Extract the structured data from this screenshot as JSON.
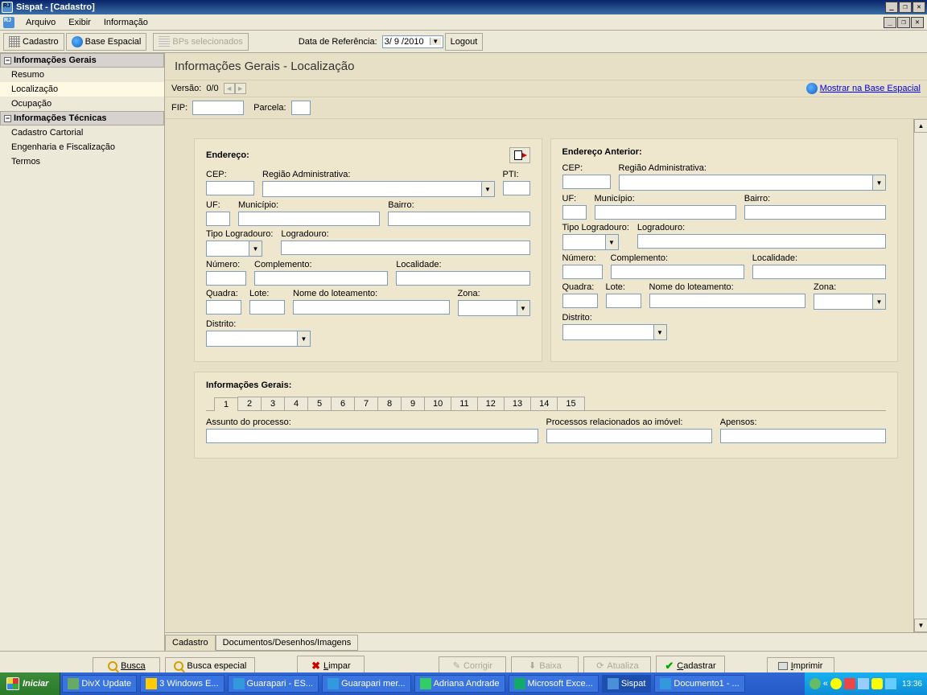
{
  "window": {
    "title": "Sispat - [Cadastro]"
  },
  "menu": {
    "arquivo": "Arquivo",
    "exibir": "Exibir",
    "informacao": "Informação"
  },
  "toolbar": {
    "cadastro": "Cadastro",
    "base_espacial": "Base Espacial",
    "bps": "BPs selecionados",
    "data_ref_label": "Data de Referência:",
    "data_ref_value": "3/ 9 /2010",
    "logout": "Logout"
  },
  "sidebar": {
    "group1": "Informações Gerais",
    "items1": {
      "resumo": "Resumo",
      "localizacao": "Localização",
      "ocupacao": "Ocupação"
    },
    "group2": "Informações Técnicas",
    "items2": {
      "cartorial": "Cadastro Cartorial",
      "engenharia": "Engenharia e Fiscalização",
      "termos": "Termos"
    }
  },
  "page": {
    "title": "Informações Gerais - Localização",
    "versao_label": "Versão:",
    "versao_value": "0/0",
    "base_link": "Mostrar na Base Espacial",
    "fip_label": "FIP:",
    "parcela_label": "Parcela:"
  },
  "endereco": {
    "title": "Endereço:",
    "title_ant": "Endereço Anterior:",
    "cep": "CEP:",
    "regiao": "Região Administrativa:",
    "pti": "PTI:",
    "uf": "UF:",
    "municipio": "Município:",
    "bairro": "Bairro:",
    "tipo_log": "Tipo Logradouro:",
    "logradouro": "Logradouro:",
    "numero": "Número:",
    "complemento": "Complemento:",
    "localidade": "Localidade:",
    "quadra": "Quadra:",
    "lote": "Lote:",
    "nome_lot": "Nome do loteamento:",
    "zona": "Zona:",
    "distrito": "Distrito:"
  },
  "info_gerais": {
    "title": "Informações Gerais:",
    "tabs": [
      "1",
      "2",
      "3",
      "4",
      "5",
      "6",
      "7",
      "8",
      "9",
      "10",
      "11",
      "12",
      "13",
      "14",
      "15"
    ],
    "assunto": "Assunto do processo:",
    "processos_rel": "Processos relacionados ao imóvel:",
    "apensos": "Apensos:"
  },
  "bottom_tabs": {
    "cadastro": "Cadastro",
    "docs": "Documentos/Desenhos/Imagens"
  },
  "buttons": {
    "busca": "Busca",
    "busca_esp": "Busca especial",
    "limpar": "Limpar",
    "corrigir": "Corrigir",
    "baixa": "Baixa",
    "atualiza": "Atualiza",
    "cadastrar": "Cadastrar",
    "imprimir": "Imprimir"
  },
  "taskbar": {
    "start": "Iniciar",
    "items": [
      "DivX Update",
      "3 Windows E...",
      "Guarapari - ES...",
      "Guarapari mer...",
      "Adriana Andrade",
      "Microsoft Exce...",
      "Sispat",
      "Documento1 - ..."
    ],
    "clock": "13:36"
  }
}
